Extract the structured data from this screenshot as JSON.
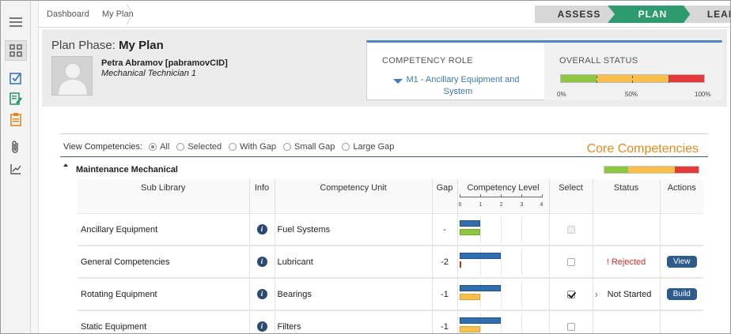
{
  "breadcrumb": {
    "items": [
      "Dashboard",
      "My Plan"
    ]
  },
  "steps": [
    {
      "label": "ASSESS",
      "active": false
    },
    {
      "label": "PLAN",
      "active": true
    },
    {
      "label": "LEARN",
      "active": false
    }
  ],
  "header": {
    "phase_label": "Plan Phase:",
    "phase_name": "My Plan",
    "user_name": "Petra Abramov [pabramovCID]",
    "user_title": "Mechanical Technician 1",
    "role_label": "COMPETENCY ROLE",
    "role_value": "M1 - Ancillary Equipment and System",
    "status_label": "OVERALL STATUS",
    "status_segments": [
      {
        "fraction": 0.25,
        "color": "#8dc63f"
      },
      {
        "fraction": 0.5,
        "color": "#fbc04a"
      },
      {
        "fraction": 0.25,
        "color": "#e53a3a"
      }
    ],
    "status_scale": [
      "0%",
      "50%",
      "100%"
    ]
  },
  "filters": {
    "label": "View Competencies:",
    "options": [
      "All",
      "Selected",
      "With Gap",
      "Small Gap",
      "Large Gap"
    ],
    "selected": "All"
  },
  "core_title": "Core Competencies",
  "section": {
    "title": "Maintenance Mechanical",
    "status_segments": [
      {
        "fraction": 0.25,
        "color": "#8dc63f"
      },
      {
        "fraction": 0.5,
        "color": "#fbc04a"
      },
      {
        "fraction": 0.25,
        "color": "#e53a3a"
      }
    ]
  },
  "table": {
    "headers": {
      "sub_library": "Sub Library",
      "info": "Info",
      "unit": "Competency Unit",
      "gap": "Gap",
      "level": "Competency Level",
      "select": "Select",
      "status": "Status",
      "actions": "Actions"
    },
    "level_scale": [
      "0",
      "1",
      "2",
      "3",
      "4"
    ],
    "rows": [
      {
        "sub_library": "Ancillary Equipment",
        "unit": "Fuel Systems",
        "gap": "-",
        "current_level": 1,
        "required_level": 1,
        "required_color": "#8dc63f",
        "select": "disabled",
        "status": "",
        "action": ""
      },
      {
        "sub_library": "General Competencies",
        "unit": "Lubricant",
        "gap": "-2",
        "current_level": 2,
        "required_level": 0,
        "required_color": "#e53a3a",
        "select": "unchecked",
        "status": "! Rejected",
        "action": "View"
      },
      {
        "sub_library": "Rotating Equipment",
        "unit": "Bearings",
        "gap": "-1",
        "current_level": 2,
        "required_level": 1,
        "required_color": "#fbc04a",
        "select": "checked",
        "status": "Not Started",
        "action": "Build"
      },
      {
        "sub_library": "Static Equipment",
        "unit": "Filters",
        "gap": "-1",
        "current_level": 2,
        "required_level": 1,
        "required_color": "#fbc04a",
        "select": "unchecked",
        "status": "",
        "action": ""
      }
    ]
  }
}
